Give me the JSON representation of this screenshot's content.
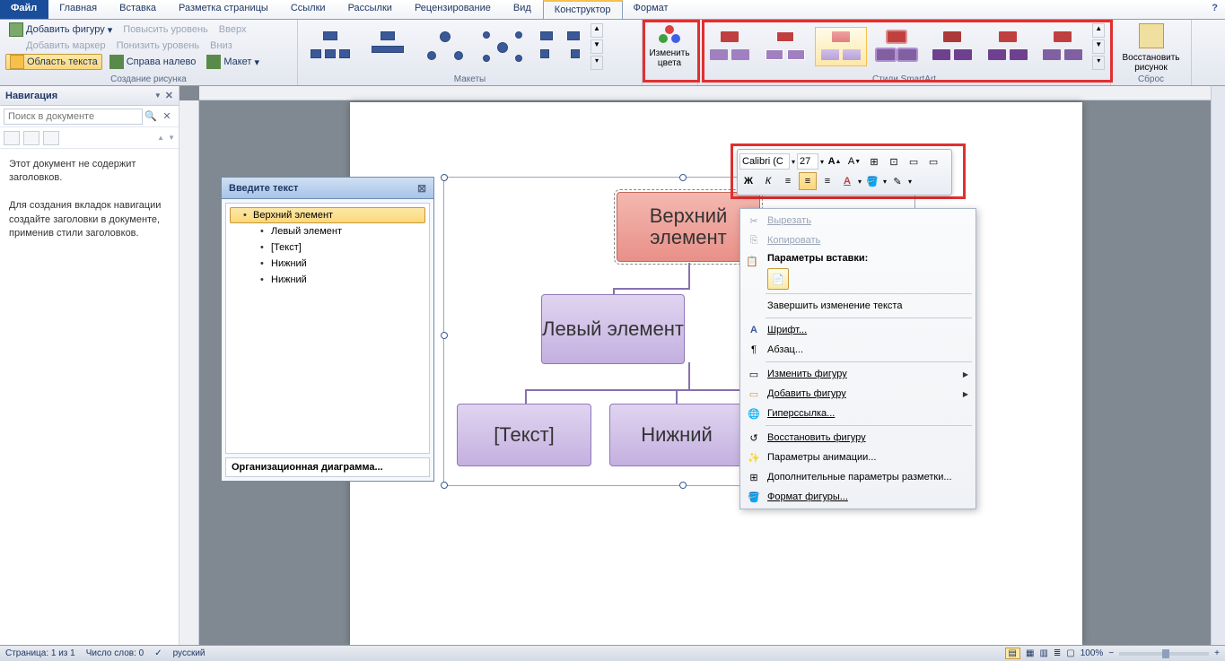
{
  "tabs": {
    "file": "Файл",
    "items": [
      "Главная",
      "Вставка",
      "Разметка страницы",
      "Ссылки",
      "Рассылки",
      "Рецензирование",
      "Вид",
      "Конструктор",
      "Формат"
    ],
    "active_index": 7
  },
  "ribbon": {
    "create": {
      "add_shape": "Добавить фигуру",
      "add_bullet": "Добавить маркер",
      "text_pane": "Область текста",
      "promote": "Повысить уровень",
      "demote": "Понизить уровень",
      "rtl": "Справа налево",
      "up": "Вверх",
      "down": "Вниз",
      "layout_btn": "Макет",
      "group_label": "Создание рисунка"
    },
    "layouts_label": "Макеты",
    "change_colors": "Изменить цвета",
    "styles_label": "Стили SmartArt",
    "reset": {
      "label": "Восстановить рисунок",
      "group": "Сброс"
    }
  },
  "nav": {
    "title": "Навигация",
    "search_placeholder": "Поиск в документе",
    "text1": "Этот документ не содержит заголовков.",
    "text2": "Для создания вкладок навигации создайте заголовки в документе, применив стили заголовков."
  },
  "text_panel": {
    "title": "Введите текст",
    "items": [
      {
        "label": "Верхний элемент",
        "indent": false,
        "selected": true
      },
      {
        "label": "Левый элемент",
        "indent": true
      },
      {
        "label": "[Текст]",
        "indent": true
      },
      {
        "label": "Нижний",
        "indent": true
      },
      {
        "label": "Нижний",
        "indent": true
      }
    ],
    "footer": "Организационная диаграмма..."
  },
  "smartart": {
    "top": "Верхний элемент",
    "left": "Левый элемент",
    "b1": "[Текст]",
    "b2": "Нижний"
  },
  "mini_toolbar": {
    "font": "Calibri (С",
    "size": "27"
  },
  "context_menu": {
    "cut": "Вырезать",
    "copy": "Копировать",
    "paste_header": "Параметры вставки:",
    "finish_edit": "Завершить изменение текста",
    "font": "Шрифт...",
    "paragraph": "Абзац...",
    "change_shape": "Изменить фигуру",
    "add_shape": "Добавить фигуру",
    "hyperlink": "Гиперссылка...",
    "restore_shape": "Восстановить фигуру",
    "anim_params": "Параметры анимации...",
    "layout_params": "Дополнительные параметры разметки...",
    "format_shape": "Формат фигуры..."
  },
  "status": {
    "page": "Страница: 1 из 1",
    "words": "Число слов: 0",
    "lang": "русский",
    "zoom": "100%"
  }
}
